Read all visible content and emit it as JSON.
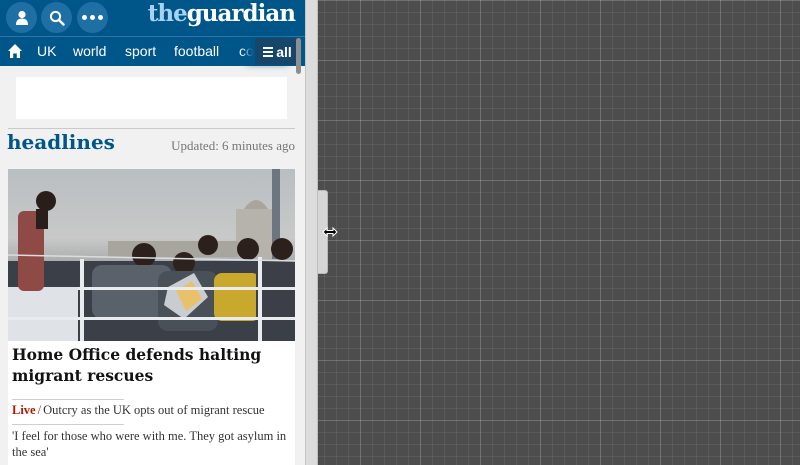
{
  "header": {
    "logo_the": "the",
    "logo_name": "guardian",
    "profile_icon": "person-icon",
    "search_icon": "search-icon",
    "more_icon": "more-dots-icon"
  },
  "nav": {
    "home_icon": "home-icon",
    "items": [
      "UK",
      "world",
      "sport",
      "football",
      "com"
    ],
    "all_label": "all",
    "all_icon": "hamburger-icon"
  },
  "section": {
    "title": "headlines",
    "updated": "Updated: 6 minutes ago"
  },
  "card": {
    "title": "Home Office defends halting migrant rescues",
    "live_label": "Live",
    "live_separator": "/",
    "sublink_1": "Outcry as the UK opts out of migrant rescue",
    "sublink_2": "'I feel for those who were with me. They got asylum in the sea'"
  },
  "colors": {
    "brand": "#005689",
    "live": "#b51800"
  },
  "workspace": {
    "resize_cursor_icon": "resize-horizontal-icon"
  }
}
